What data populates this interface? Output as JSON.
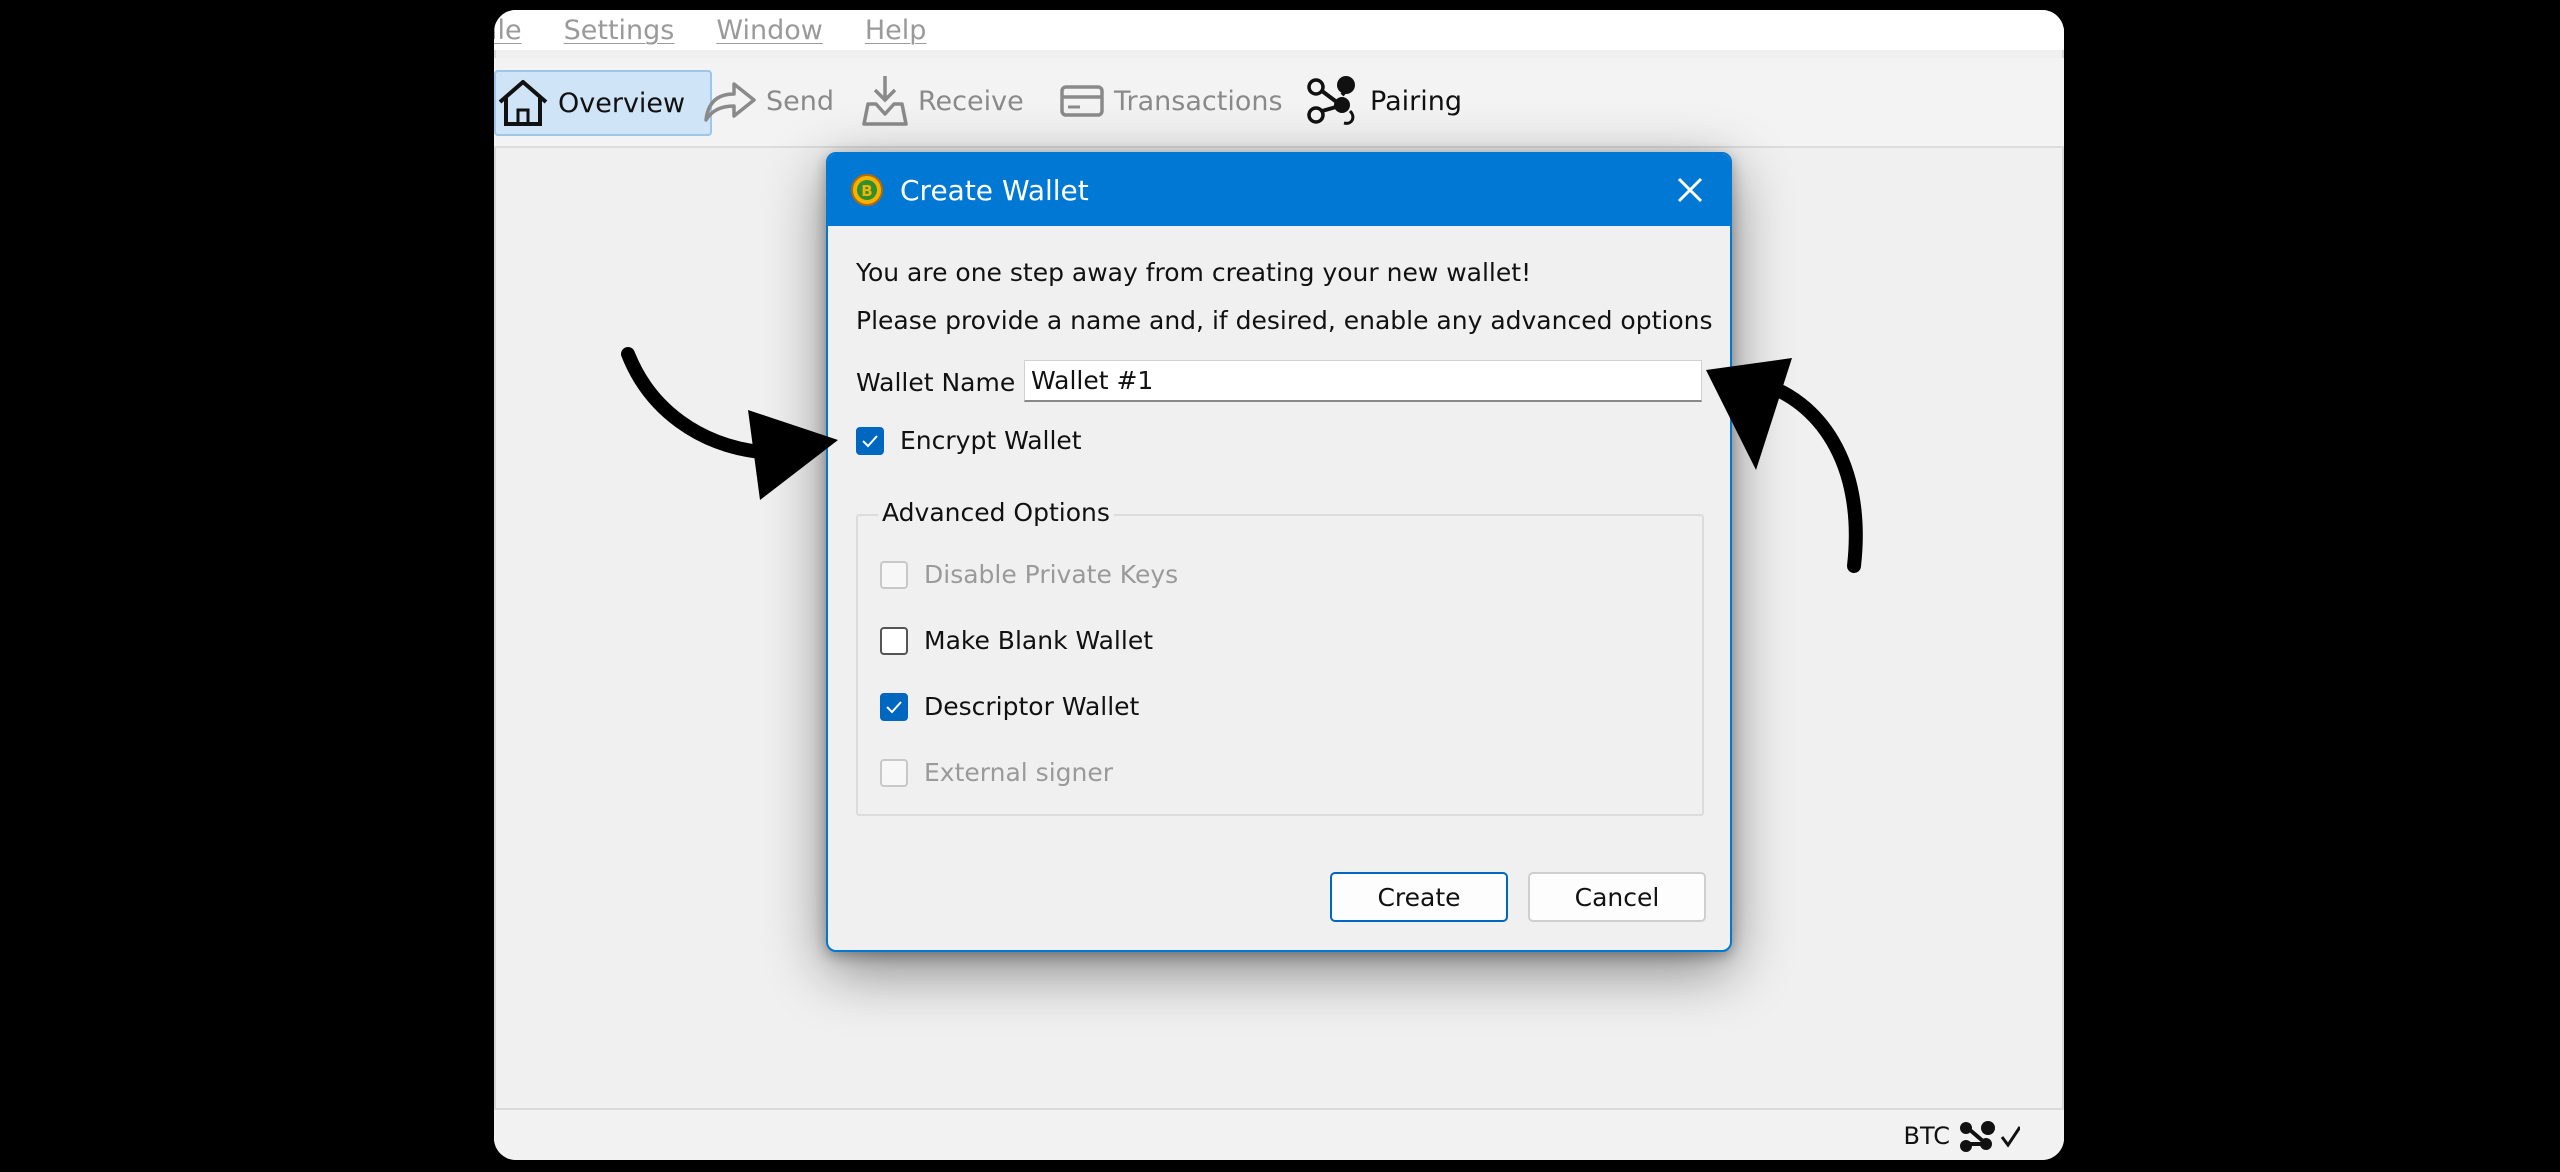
{
  "menu": {
    "items": [
      "File",
      "Settings",
      "Window",
      "Help"
    ],
    "first_visible": "ile"
  },
  "toolbar": {
    "overview": "Overview",
    "send": "Send",
    "receive": "Receive",
    "transactions": "Transactions",
    "pairing": "Pairing"
  },
  "dialog": {
    "title": "Create Wallet",
    "line1": "You are one step away from creating your new wallet!",
    "line2": "Please provide a name and, if desired, enable any advanced options",
    "wallet_name_label": "Wallet Name",
    "wallet_name_value": "Wallet #1",
    "encrypt_label": "Encrypt Wallet",
    "encrypt_checked": true,
    "advanced_title": "Advanced Options",
    "options": [
      {
        "label": "Disable Private Keys",
        "checked": false,
        "enabled": false
      },
      {
        "label": "Make Blank Wallet",
        "checked": false,
        "enabled": true
      },
      {
        "label": "Descriptor Wallet",
        "checked": true,
        "enabled": true
      },
      {
        "label": "External signer",
        "checked": false,
        "enabled": false
      }
    ],
    "create_label": "Create",
    "cancel_label": "Cancel"
  },
  "statusbar": {
    "unit": "BTC"
  },
  "colors": {
    "accent": "#0078d4",
    "checkbox": "#0067c0",
    "background": "#000000"
  },
  "icons": [
    "home-icon",
    "send-icon",
    "receive-icon",
    "transactions-icon",
    "pairing-icon",
    "bitcoin-icon",
    "close-icon",
    "checkmark-icon",
    "arrow-annotation"
  ]
}
